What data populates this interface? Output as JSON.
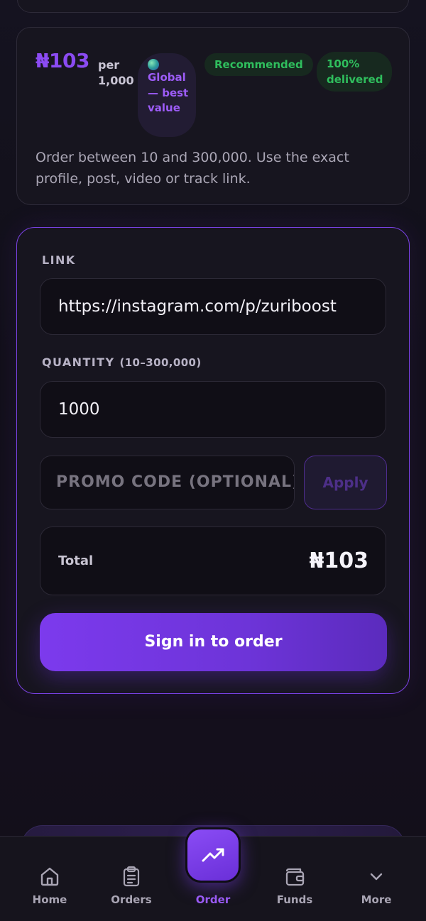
{
  "service": {
    "price": "₦103",
    "per_unit": "per 1,000",
    "badges": {
      "global": "Global — best value",
      "recommended": "Recommended",
      "delivered": "100% delivered"
    },
    "description": "Order between 10 and 300,000. Use the exact profile, post, video or track link."
  },
  "form": {
    "link_label": "LINK",
    "link_value": "https://instagram.com/p/zuriboost",
    "quantity_label": "QUANTITY",
    "quantity_range": "(10–300,000)",
    "quantity_value": "1000",
    "promo_placeholder": "PROMO CODE (OPTIONAL)",
    "apply_label": "Apply",
    "total_label": "Total",
    "total_value": "₦103",
    "signin_label": "Sign in to order"
  },
  "nav": {
    "items": [
      {
        "label": "Home",
        "icon": "home-icon"
      },
      {
        "label": "Orders",
        "icon": "clipboard-icon"
      },
      {
        "label": "Order",
        "icon": "trending-up-icon",
        "active": true
      },
      {
        "label": "Funds",
        "icon": "wallet-icon"
      },
      {
        "label": "More",
        "icon": "chevron-down-icon"
      }
    ]
  },
  "colors": {
    "accent": "#7c3aed",
    "success": "#2fbe5d",
    "background": "#15131c"
  }
}
